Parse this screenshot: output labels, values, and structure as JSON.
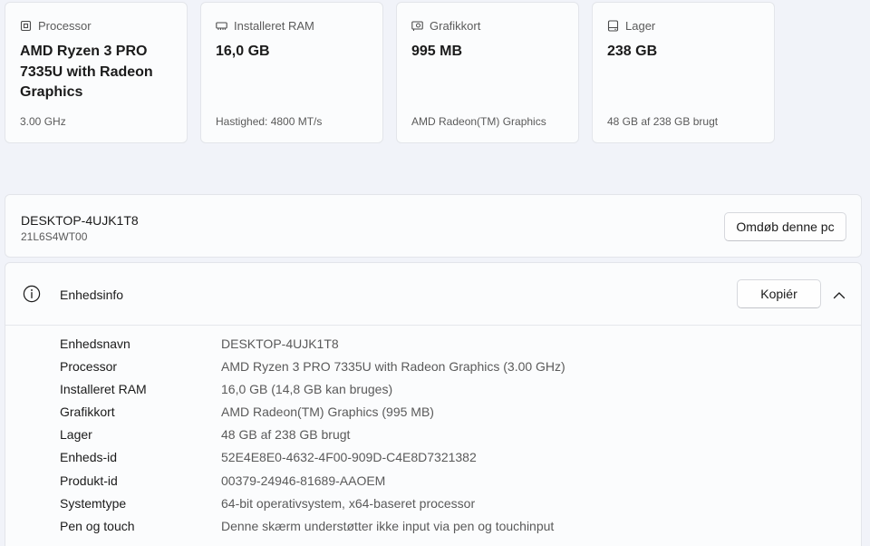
{
  "cards": [
    {
      "icon": "processor-icon",
      "label": "Processor",
      "value": "AMD Ryzen 3 PRO 7335U with Radeon Graphics",
      "sub": "3.00 GHz"
    },
    {
      "icon": "ram-icon",
      "label": "Installeret RAM",
      "value": "16,0 GB",
      "sub": "Hastighed: 4800 MT/s"
    },
    {
      "icon": "graphics-card-icon",
      "label": "Grafikkort",
      "value": "995 MB",
      "sub": "AMD Radeon(TM) Graphics"
    },
    {
      "icon": "storage-icon",
      "label": "Lager",
      "value": "238 GB",
      "sub": "48 GB af 238 GB brugt"
    }
  ],
  "device": {
    "name": "DESKTOP-4UJK1T8",
    "model": "21L6S4WT00",
    "rename_label": "Omdøb denne pc"
  },
  "device_info": {
    "title": "Enhedsinfo",
    "copy_label": "Kopiér",
    "rows": [
      {
        "label": "Enhedsnavn",
        "value": "DESKTOP-4UJK1T8"
      },
      {
        "label": "Processor",
        "value": "AMD Ryzen 3 PRO 7335U with Radeon Graphics (3.00 GHz)"
      },
      {
        "label": "Installeret RAM",
        "value": "16,0 GB (14,8 GB kan bruges)"
      },
      {
        "label": "Grafikkort",
        "value": "AMD Radeon(TM) Graphics (995 MB)"
      },
      {
        "label": "Lager",
        "value": "48 GB af 238 GB brugt"
      },
      {
        "label": "Enheds-id",
        "value": "52E4E8E0-4632-4F00-909D-C4E8D7321382"
      },
      {
        "label": "Produkt-id",
        "value": "00379-24946-81689-AAOEM"
      },
      {
        "label": "Systemtype",
        "value": "64-bit operativsystem, x64-baseret processor"
      },
      {
        "label": "Pen og touch",
        "value": "Denne skærm understøtter ikke input via pen og touchinput"
      }
    ]
  }
}
